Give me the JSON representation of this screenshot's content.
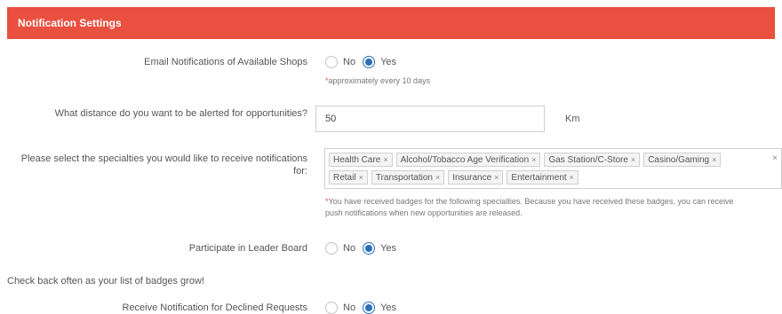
{
  "header": {
    "title": "Notification Settings"
  },
  "email": {
    "label": "Email Notifications of Available Shops",
    "no_label": "No",
    "yes_label": "Yes",
    "selected": "Yes",
    "note_star": "*",
    "note": "approximately every 10 days"
  },
  "distance": {
    "label": "What distance do you want to be alerted for opportunities?",
    "value": "50",
    "unit": "Km"
  },
  "specialties": {
    "label_line1": "Please select the specialties you would like to receive notifications",
    "label_line2": "for:",
    "tags_row1": [
      "Health Care",
      "Alcohol/Tobacco Age Verification",
      "Gas Station/C-Store",
      "Casino/Gaming"
    ],
    "tags_row2": [
      "Retail",
      "Transportation",
      "Insurance",
      "Entertainment"
    ],
    "remove_glyph": "×",
    "note_star": "*",
    "note_line1": "You have received badges for the following specialties. Because you have received these badges, you can receive",
    "note_line2": "push notifications when new opportunities are released."
  },
  "leaderboard": {
    "label": "Participate in Leader Board",
    "no_label": "No",
    "yes_label": "Yes",
    "selected": "Yes"
  },
  "badges_text": "Check back often as your list of badges grow!",
  "declined": {
    "label": "Receive Notification for Declined Requests",
    "no_label": "No",
    "yes_label": "Yes",
    "selected": "Yes"
  },
  "colors": {
    "header_bg": "#e9503f",
    "radio_selected": "#2b6fb8"
  },
  "icons": {
    "tag_remove": "close-icon",
    "clear_all": "close-icon"
  }
}
